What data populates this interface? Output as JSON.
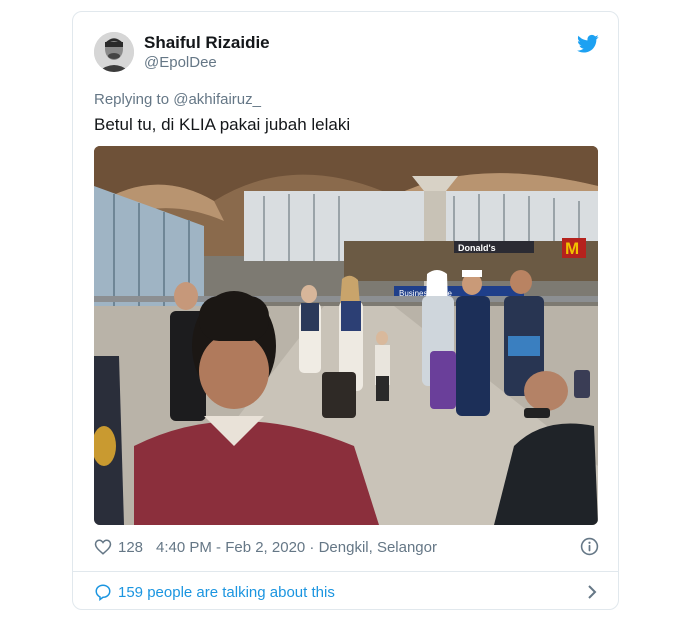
{
  "tweet": {
    "author_name": "Shaiful Rizaidie",
    "author_handle": "@EpolDee",
    "replying_to": "Replying to @akhifairuz_",
    "text": "Betul tu, di KLIA pakai jubah lelaki",
    "like_count": "128",
    "timestamp": "4:40 PM - Feb 2, 2020 · Dengkil, Selangor",
    "talking_about": "159 people are talking about this"
  },
  "media": {
    "store_sign_1": "Donald's",
    "store_sign_2": "Business Suite"
  },
  "colors": {
    "brand_blue": "#1da1f2",
    "link_blue": "#1b95e0",
    "secondary_text": "#657786",
    "border": "#e1e8ed"
  },
  "icons": {
    "logo": "twitter-bird-icon",
    "like": "heart-icon",
    "info": "info-icon",
    "talk": "speech-bubble-icon",
    "more": "chevron-right-icon"
  }
}
